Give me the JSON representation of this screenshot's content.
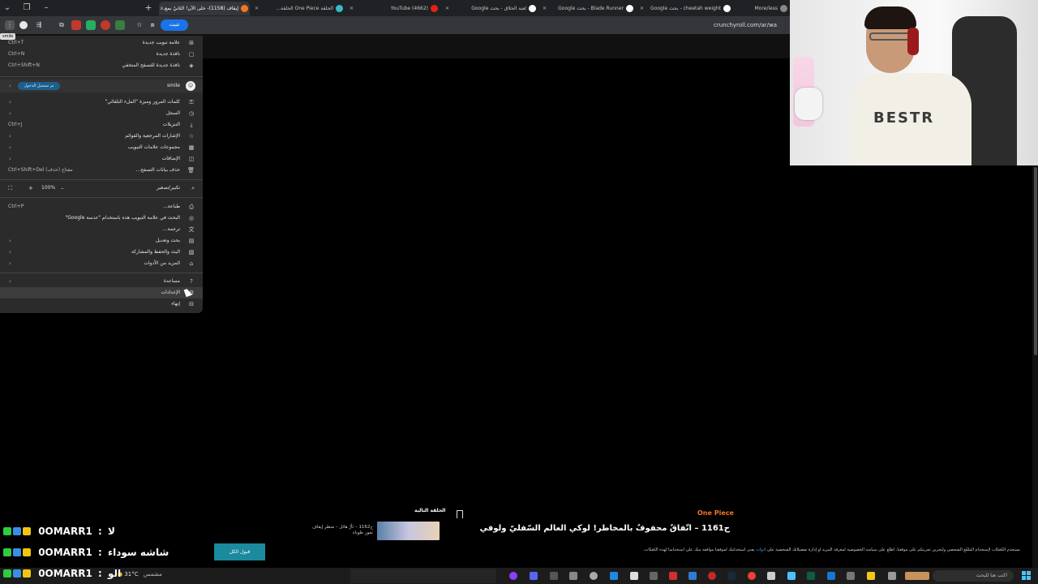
{
  "browser": {
    "tabs": [
      {
        "label": "إيقاف (1158)- حلى الآن! الثانيُ بمع...",
        "active": true
      },
      {
        "label": "الحلقة One Piece الحلقة..."
      },
      {
        "label": "(4662) YouTube"
      },
      {
        "label": "لعبة الحلاق - بحث Google"
      },
      {
        "label": "Blade Runner - بحث Google"
      },
      {
        "label": "cheetah weight - بحث Google"
      },
      {
        "label": "More/less"
      }
    ],
    "install_label": "تثبيت",
    "url": "crunchyroll.com/ar/wa",
    "tooltip": "smile"
  },
  "menu": {
    "items_top": [
      {
        "label": "علامة تبويب جديدة",
        "shortcut": "Ctrl+T"
      },
      {
        "label": "نافذة جديدة",
        "shortcut": "Ctrl+N"
      },
      {
        "label": "نافذة جديدة للتصفح المتخفي",
        "shortcut": "Ctrl+Shift+N"
      }
    ],
    "profile": {
      "name": "smile",
      "status": "تم تسجيل الدخول"
    },
    "items_mid": [
      {
        "label": "كلمات المرور وميزة \"الملء التلقائي\"",
        "arrow": true
      },
      {
        "label": "السجل",
        "arrow": true
      },
      {
        "label": "التنزيلات",
        "shortcut": "Ctrl+J"
      },
      {
        "label": "الإشارات المرجعية والقوائم",
        "arrow": true
      },
      {
        "label": "مجموعات علامات التبويب",
        "arrow": true
      },
      {
        "label": "الإضافات",
        "arrow": true
      },
      {
        "label": "حذف بيانات التصفح...",
        "shortcut": "Ctrl+Shift+Del (حذف) مفتاح"
      }
    ],
    "zoom": {
      "label": "تكبير/تصغير",
      "value": "100%",
      "minus": "–",
      "plus": "+"
    },
    "items_tools": [
      {
        "label": "طباعة...",
        "shortcut": "Ctrl+P"
      },
      {
        "label": "البحث في علامة التبويب هذه باستخدام \"عدسة Google\""
      },
      {
        "label": "ترجمة..."
      },
      {
        "label": "بحث وتعديل",
        "arrow": true
      },
      {
        "label": "البث والحفظ والمشاركة",
        "arrow": true
      },
      {
        "label": "المزيد من الأدوات",
        "arrow": true
      }
    ],
    "items_bottom": [
      {
        "label": "مساعدة",
        "arrow": true
      },
      {
        "label": "الإعدادات"
      },
      {
        "label": "إنهاء"
      }
    ]
  },
  "episode": {
    "series": "One Piece",
    "title": "ح1161 – اتّفاقٌ محفوفٌ بالمخاطر! لوكي العالم السّفليّ ولوفي",
    "next_label": "الحلقة التالية",
    "next_title": "ح1162 – ثأرٌ هائل – منظر إيقاف نمور طوباءِ",
    "privacy_text": "نستخدم الكعكات لإستخدام الملفّع الشخصي ولنحرين تجربتكم على موقعنا. اطلع على سياسة الخصوصية لمعرفة المزيد أو إدارة تفضيلاتك الشخصية على",
    "privacy_link": "أدوات",
    "privacy_tail": "يعني استخدامك لموقعنا موافقة منك على استخدامنا لهذه الكعكات.",
    "accept_label": "قبول الكل"
  },
  "chat": [
    {
      "user": "0OMARR1",
      "message": "لا"
    },
    {
      "user": "0OMARR1",
      "message": "شاشه سوداء"
    },
    {
      "user": "0OMARR1",
      "message": "الو"
    }
  ],
  "taskbar": {
    "temperature": "31°C",
    "condition": "مشمس",
    "search_placeholder": "اكتب هنا للبحث"
  },
  "colors": {
    "accent": "#f47521",
    "menu_bg": "#2b2b2b",
    "accept_btn": "#1a8a9c",
    "link": "#3fa9f5"
  }
}
